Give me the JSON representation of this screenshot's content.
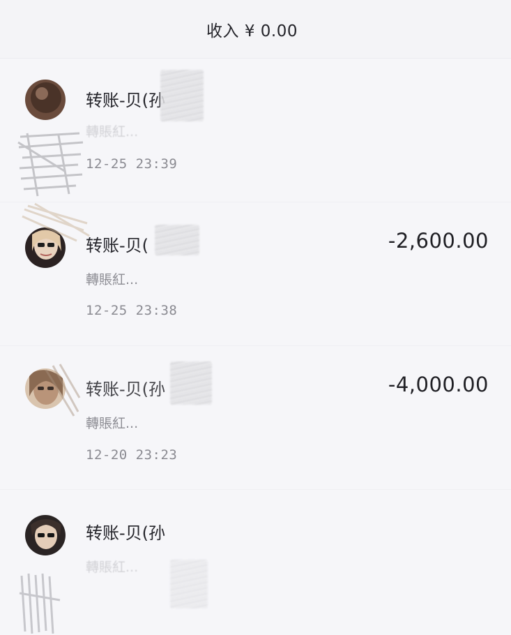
{
  "header": {
    "income_label": "收入 ¥ 0.00"
  },
  "transactions": [
    {
      "title": "转账-贝(孙",
      "subtitle": "轉賬紅...",
      "time": "12-25 23:39",
      "amount": ""
    },
    {
      "title": "转账-贝(",
      "subtitle": "轉賬紅...",
      "time": "12-25 23:38",
      "amount": "-2,600.00"
    },
    {
      "title": "转账-贝(孙",
      "subtitle": "轉賬紅...",
      "time": "12-20 23:23",
      "amount": "-4,000.00"
    },
    {
      "title": "转账-贝(孙",
      "subtitle": "轉賬紅...",
      "time": "",
      "amount": ""
    }
  ]
}
